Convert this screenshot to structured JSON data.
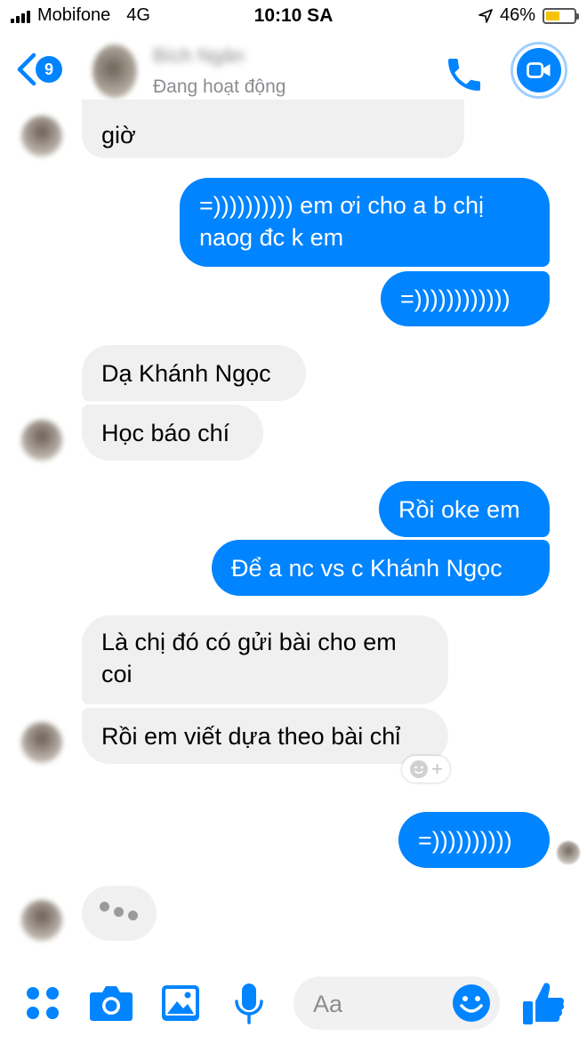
{
  "status_bar": {
    "carrier": "Mobifone",
    "network": "4G",
    "time": "10:10 SA",
    "battery": "46%",
    "battery_level": 0.46
  },
  "header": {
    "unread_count": "9",
    "contact_name": "Bích Ngân",
    "contact_status": "Đang hoạt động",
    "icons": [
      "back-chevron-icon",
      "phone-icon",
      "video-camera-icon"
    ]
  },
  "messages": [
    {
      "side": "in",
      "lines": [
        "giờ"
      ]
    },
    {
      "side": "out",
      "lines": [
        "=)))))))))) em ơi cho a b chị",
        "naog đc k em"
      ]
    },
    {
      "side": "out",
      "lines": [
        "=))))))))))))"
      ]
    },
    {
      "side": "in",
      "lines": [
        "Dạ Khánh Ngọc"
      ]
    },
    {
      "side": "in",
      "lines": [
        "Học báo chí"
      ]
    },
    {
      "side": "out",
      "lines": [
        "Rồi oke em"
      ]
    },
    {
      "side": "out",
      "lines": [
        "Để a nc vs c Khánh Ngọc"
      ]
    },
    {
      "side": "in",
      "lines": [
        "Là chị đó có gửi bài cho em",
        "coi"
      ]
    },
    {
      "side": "in",
      "lines": [
        "Rồi em viết dựa theo bài chỉ"
      ]
    },
    {
      "side": "out",
      "lines": [
        "=))))))))))"
      ]
    }
  ],
  "composer": {
    "placeholder": "Aa",
    "icons": [
      "apps-icon",
      "camera-icon",
      "image-icon",
      "microphone-icon",
      "emoji-icon",
      "like-icon"
    ]
  },
  "colors": {
    "accent": "#0084ff",
    "incoming_bubble": "#f0f0f0",
    "text_secondary": "#8a8d91"
  }
}
